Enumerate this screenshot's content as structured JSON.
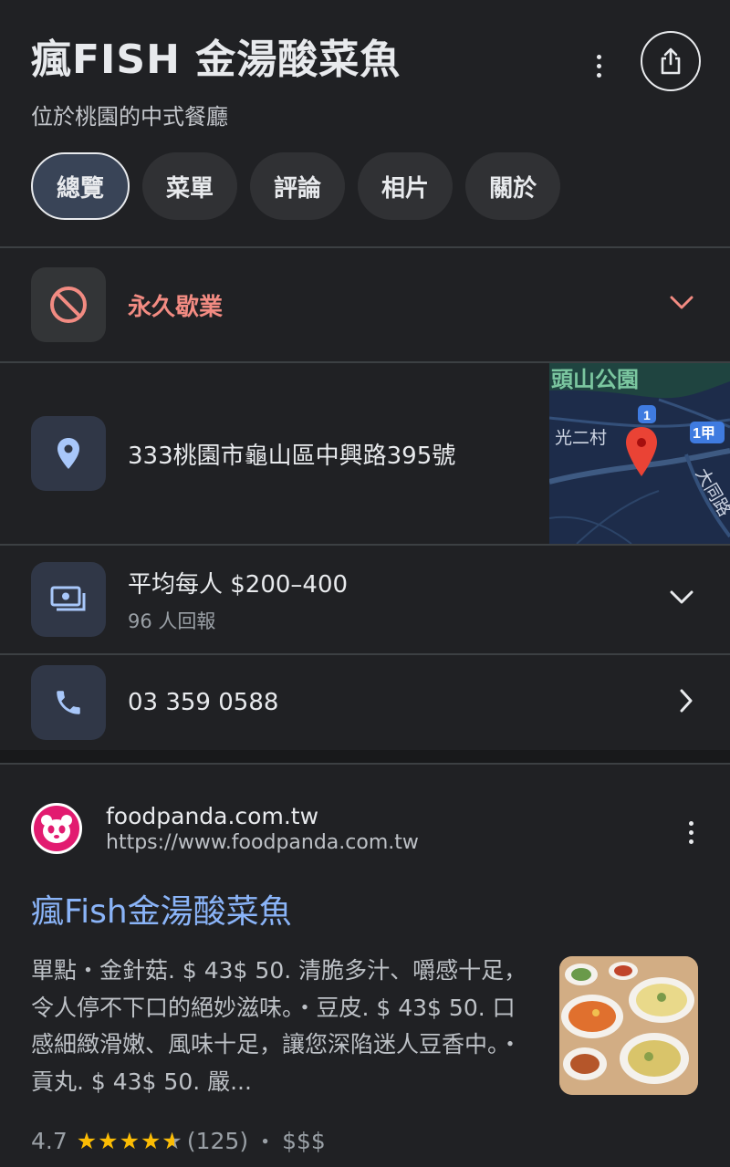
{
  "place": {
    "title": "瘋FISH 金湯酸菜魚",
    "subtitle": "位於桃園的中式餐廳"
  },
  "tabs": [
    {
      "label": "總覽",
      "active": true
    },
    {
      "label": "菜單",
      "active": false
    },
    {
      "label": "評論",
      "active": false
    },
    {
      "label": "相片",
      "active": false
    },
    {
      "label": "關於",
      "active": false
    }
  ],
  "status": {
    "text": "永久歇業",
    "color": "#f28b82"
  },
  "address": {
    "text": "333桃園市龜山區中興路395號"
  },
  "map": {
    "label_park": "頭山公園",
    "label_village": "光二村",
    "label_road": "大同路",
    "route_1": "1",
    "route_1a": "1甲"
  },
  "price": {
    "text": "平均每人 $200–400",
    "sub": "96 人回報"
  },
  "phone": {
    "text": "03 359 0588"
  },
  "result": {
    "site_name": "foodpanda.com.tw",
    "site_url": "https://www.foodpanda.com.tw",
    "title": "瘋Fish金湯酸菜魚",
    "snippet": "單點・金針菇. $ 43$ 50. 清脆多汁、嚼感十足，令人停不下口的絕妙滋味。・豆皮. $ 43$ 50. 口感細緻滑嫩、風味十足，讓您深陷迷人豆香中。・貢丸. $ 43$ 50. 嚴...",
    "rating": "4.7",
    "stars": "★★★★★",
    "review_count": "(125)",
    "separator": "・",
    "price_level": "$$$"
  }
}
